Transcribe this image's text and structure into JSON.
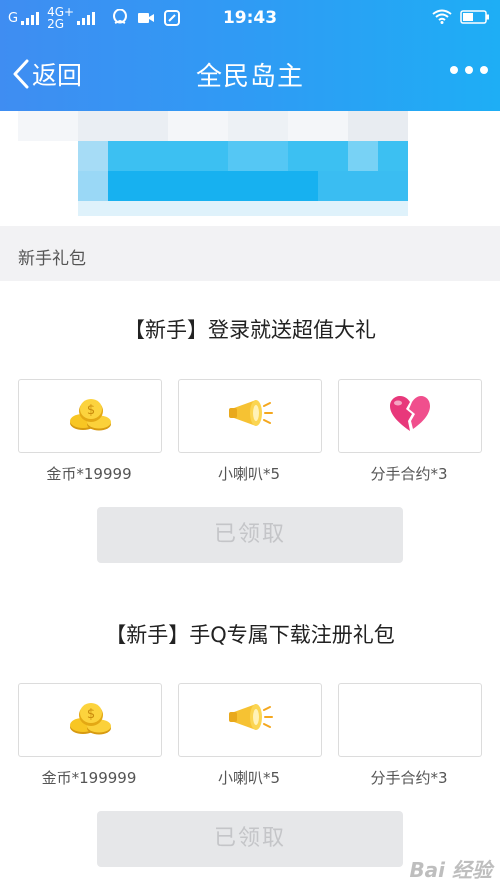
{
  "status_bar": {
    "network_left": "G",
    "network_4g": "4G+",
    "network_2g": "2G",
    "time": "19:43"
  },
  "nav": {
    "back_label": "返回",
    "title": "全民岛主"
  },
  "section": {
    "label": "新手礼包"
  },
  "packs": [
    {
      "title": "【新手】登录就送超值大礼",
      "items": [
        {
          "icon": "gold-coins-icon",
          "label": "金币*19999"
        },
        {
          "icon": "megaphone-icon",
          "label": "小喇叭*5"
        },
        {
          "icon": "broken-heart-icon",
          "label": "分手合约*3"
        }
      ],
      "button": "已领取"
    },
    {
      "title": "【新手】手Q专属下载注册礼包",
      "items": [
        {
          "icon": "gold-coins-icon",
          "label": "金币*199999"
        },
        {
          "icon": "megaphone-icon",
          "label": "小喇叭*5"
        },
        {
          "icon": "empty",
          "label": "分手合约*3"
        }
      ],
      "button": "已领取"
    }
  ],
  "watermark": "Bai 经验",
  "colors": {
    "header_start": "#3f8df2",
    "header_end": "#1eaef5",
    "section_bg": "#f2f2f4",
    "disabled_button": "#e6e7e9"
  }
}
